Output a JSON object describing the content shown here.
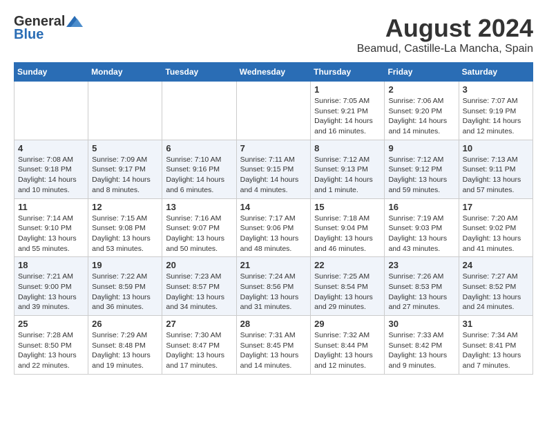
{
  "header": {
    "logo_general": "General",
    "logo_blue": "Blue",
    "month_title": "August 2024",
    "location": "Beamud, Castille-La Mancha, Spain"
  },
  "calendar": {
    "weekdays": [
      "Sunday",
      "Monday",
      "Tuesday",
      "Wednesday",
      "Thursday",
      "Friday",
      "Saturday"
    ],
    "weeks": [
      [
        {
          "date": "",
          "info": ""
        },
        {
          "date": "",
          "info": ""
        },
        {
          "date": "",
          "info": ""
        },
        {
          "date": "",
          "info": ""
        },
        {
          "date": "1",
          "info": "Sunrise: 7:05 AM\nSunset: 9:21 PM\nDaylight: 14 hours and 16 minutes."
        },
        {
          "date": "2",
          "info": "Sunrise: 7:06 AM\nSunset: 9:20 PM\nDaylight: 14 hours and 14 minutes."
        },
        {
          "date": "3",
          "info": "Sunrise: 7:07 AM\nSunset: 9:19 PM\nDaylight: 14 hours and 12 minutes."
        }
      ],
      [
        {
          "date": "4",
          "info": "Sunrise: 7:08 AM\nSunset: 9:18 PM\nDaylight: 14 hours and 10 minutes."
        },
        {
          "date": "5",
          "info": "Sunrise: 7:09 AM\nSunset: 9:17 PM\nDaylight: 14 hours and 8 minutes."
        },
        {
          "date": "6",
          "info": "Sunrise: 7:10 AM\nSunset: 9:16 PM\nDaylight: 14 hours and 6 minutes."
        },
        {
          "date": "7",
          "info": "Sunrise: 7:11 AM\nSunset: 9:15 PM\nDaylight: 14 hours and 4 minutes."
        },
        {
          "date": "8",
          "info": "Sunrise: 7:12 AM\nSunset: 9:13 PM\nDaylight: 14 hours and 1 minute."
        },
        {
          "date": "9",
          "info": "Sunrise: 7:12 AM\nSunset: 9:12 PM\nDaylight: 13 hours and 59 minutes."
        },
        {
          "date": "10",
          "info": "Sunrise: 7:13 AM\nSunset: 9:11 PM\nDaylight: 13 hours and 57 minutes."
        }
      ],
      [
        {
          "date": "11",
          "info": "Sunrise: 7:14 AM\nSunset: 9:10 PM\nDaylight: 13 hours and 55 minutes."
        },
        {
          "date": "12",
          "info": "Sunrise: 7:15 AM\nSunset: 9:08 PM\nDaylight: 13 hours and 53 minutes."
        },
        {
          "date": "13",
          "info": "Sunrise: 7:16 AM\nSunset: 9:07 PM\nDaylight: 13 hours and 50 minutes."
        },
        {
          "date": "14",
          "info": "Sunrise: 7:17 AM\nSunset: 9:06 PM\nDaylight: 13 hours and 48 minutes."
        },
        {
          "date": "15",
          "info": "Sunrise: 7:18 AM\nSunset: 9:04 PM\nDaylight: 13 hours and 46 minutes."
        },
        {
          "date": "16",
          "info": "Sunrise: 7:19 AM\nSunset: 9:03 PM\nDaylight: 13 hours and 43 minutes."
        },
        {
          "date": "17",
          "info": "Sunrise: 7:20 AM\nSunset: 9:02 PM\nDaylight: 13 hours and 41 minutes."
        }
      ],
      [
        {
          "date": "18",
          "info": "Sunrise: 7:21 AM\nSunset: 9:00 PM\nDaylight: 13 hours and 39 minutes."
        },
        {
          "date": "19",
          "info": "Sunrise: 7:22 AM\nSunset: 8:59 PM\nDaylight: 13 hours and 36 minutes."
        },
        {
          "date": "20",
          "info": "Sunrise: 7:23 AM\nSunset: 8:57 PM\nDaylight: 13 hours and 34 minutes."
        },
        {
          "date": "21",
          "info": "Sunrise: 7:24 AM\nSunset: 8:56 PM\nDaylight: 13 hours and 31 minutes."
        },
        {
          "date": "22",
          "info": "Sunrise: 7:25 AM\nSunset: 8:54 PM\nDaylight: 13 hours and 29 minutes."
        },
        {
          "date": "23",
          "info": "Sunrise: 7:26 AM\nSunset: 8:53 PM\nDaylight: 13 hours and 27 minutes."
        },
        {
          "date": "24",
          "info": "Sunrise: 7:27 AM\nSunset: 8:52 PM\nDaylight: 13 hours and 24 minutes."
        }
      ],
      [
        {
          "date": "25",
          "info": "Sunrise: 7:28 AM\nSunset: 8:50 PM\nDaylight: 13 hours and 22 minutes."
        },
        {
          "date": "26",
          "info": "Sunrise: 7:29 AM\nSunset: 8:48 PM\nDaylight: 13 hours and 19 minutes."
        },
        {
          "date": "27",
          "info": "Sunrise: 7:30 AM\nSunset: 8:47 PM\nDaylight: 13 hours and 17 minutes."
        },
        {
          "date": "28",
          "info": "Sunrise: 7:31 AM\nSunset: 8:45 PM\nDaylight: 13 hours and 14 minutes."
        },
        {
          "date": "29",
          "info": "Sunrise: 7:32 AM\nSunset: 8:44 PM\nDaylight: 13 hours and 12 minutes."
        },
        {
          "date": "30",
          "info": "Sunrise: 7:33 AM\nSunset: 8:42 PM\nDaylight: 13 hours and 9 minutes."
        },
        {
          "date": "31",
          "info": "Sunrise: 7:34 AM\nSunset: 8:41 PM\nDaylight: 13 hours and 7 minutes."
        }
      ]
    ]
  }
}
